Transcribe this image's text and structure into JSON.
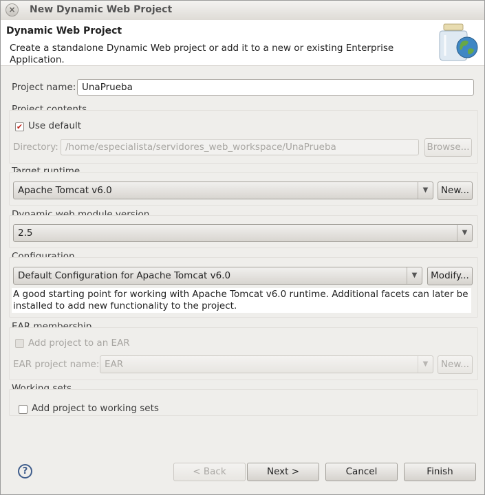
{
  "window": {
    "title": "New Dynamic Web Project",
    "close_glyph": "×"
  },
  "header": {
    "title": "Dynamic Web Project",
    "description": "Create a standalone Dynamic Web project or add it to a new or existing Enterprise Application.",
    "icon": "web-project-jar-globe-icon"
  },
  "project_name": {
    "label": "Project name:",
    "value": "UnaPrueba"
  },
  "project_contents": {
    "label": "Project contents",
    "use_default_label": "Use default",
    "use_default_checked": true,
    "directory_label": "Directory:",
    "directory_value": "/home/especialista/servidores_web_workspace/UnaPrueba",
    "browse_label": "Browse..."
  },
  "target_runtime": {
    "label": "Target runtime",
    "selected": "Apache Tomcat v6.0",
    "new_label": "New..."
  },
  "web_module": {
    "label": "Dynamic web module version",
    "selected": "2.5"
  },
  "configuration": {
    "label": "Configuration",
    "selected": "Default Configuration for Apache Tomcat v6.0",
    "modify_label": "Modify...",
    "description": "A good starting point for working with Apache Tomcat v6.0 runtime. Additional facets can later be installed to add new functionality to the project."
  },
  "ear": {
    "label": "EAR membership",
    "add_label": "Add project to an EAR",
    "add_checked": false,
    "name_label": "EAR project name:",
    "name_value": "EAR",
    "new_label": "New..."
  },
  "working_sets": {
    "label": "Working sets",
    "add_label": "Add project to working sets",
    "add_checked": false
  },
  "footer": {
    "help_glyph": "?",
    "back_label": "< Back",
    "next_label": "Next >",
    "cancel_label": "Cancel",
    "finish_label": "Finish"
  },
  "glyphs": {
    "dropdown_arrow": "▼",
    "checkmark": "✔"
  }
}
